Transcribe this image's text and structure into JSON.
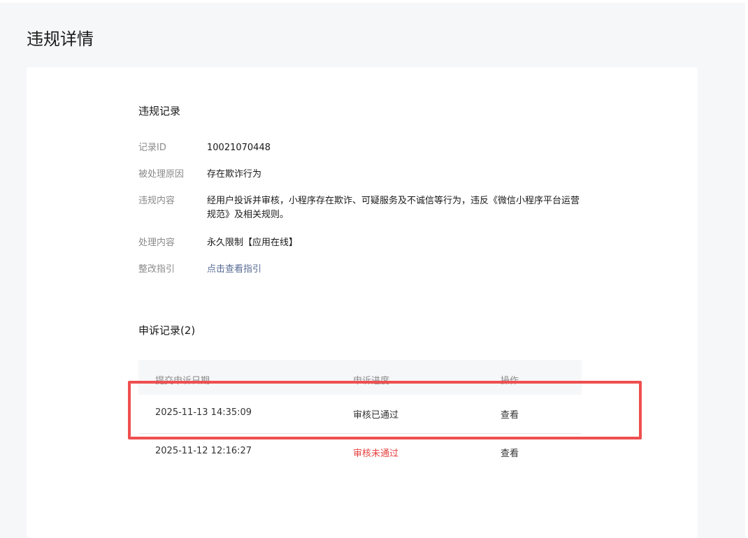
{
  "page": {
    "title": "违规详情"
  },
  "violation": {
    "section_title": "违规记录",
    "fields": [
      {
        "label": "记录ID",
        "value": "10021070448"
      },
      {
        "label": "被处理原因",
        "value": "存在欺诈行为"
      },
      {
        "label": "违规内容",
        "value": "经用户投诉并审核，小程序存在欺诈、可疑服务及不诚信等行为，违反《微信小程序平台运营规范》及相关规则。"
      },
      {
        "label": "处理内容",
        "value": "永久限制【应用在线】"
      },
      {
        "label": "整改指引",
        "value": "点击查看指引"
      }
    ]
  },
  "appeal": {
    "section_title": "申诉记录(2)",
    "columns": [
      "提交申诉日期",
      "申诉进度",
      "操作"
    ],
    "rows": [
      {
        "date": "2025-11-13 14:35:09",
        "status": "审核已通过",
        "action": "查看"
      },
      {
        "date": "2025-11-12 12:16:27",
        "status": "审核未通过",
        "action": "查看"
      }
    ]
  },
  "colors": {
    "link": "#576b95",
    "fail": "#e64340",
    "highlight_border": "#ef4f4f"
  }
}
